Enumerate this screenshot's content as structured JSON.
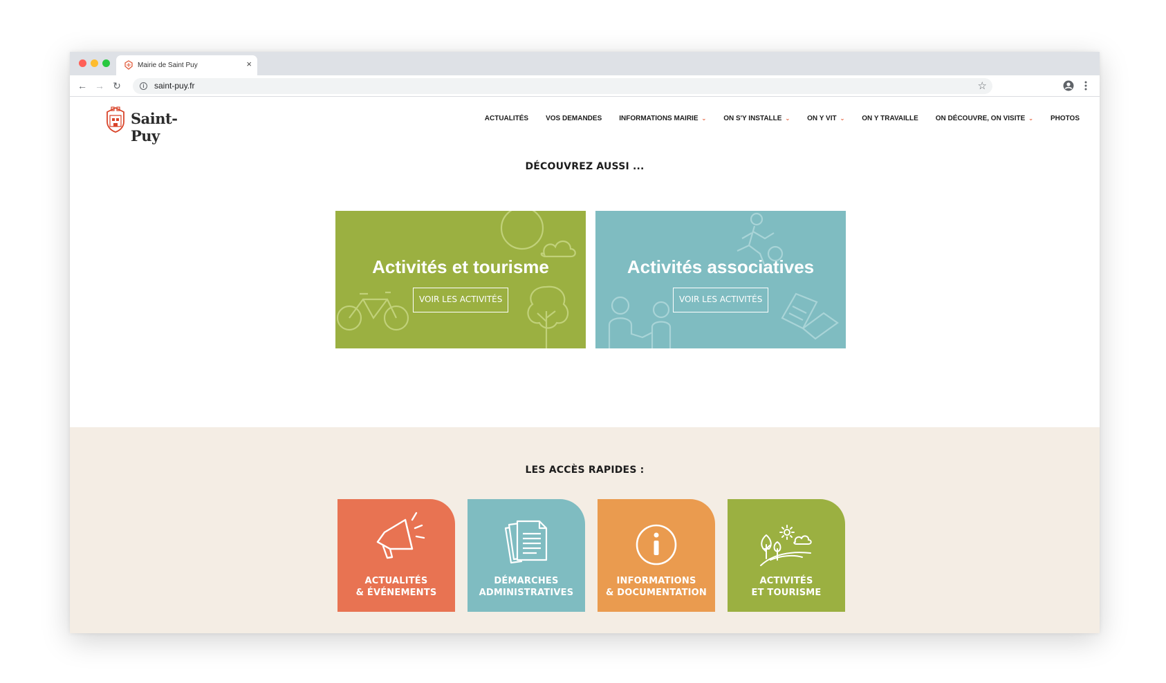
{
  "browser": {
    "tab_title": "Mairie de Saint Puy",
    "tab_close": "×",
    "url": "saint-puy.fr",
    "back": "←",
    "forward": "→",
    "reload": "↻",
    "info": "i",
    "star": "☆"
  },
  "site": {
    "logo_text": "Saint-Puy",
    "nav": [
      {
        "label": "ACTUALITÉS",
        "has_dropdown": false
      },
      {
        "label": "VOS DEMANDES",
        "has_dropdown": false
      },
      {
        "label": "INFORMATIONS MAIRIE",
        "has_dropdown": true
      },
      {
        "label": "ON S'Y INSTALLE",
        "has_dropdown": true
      },
      {
        "label": "ON Y VIT",
        "has_dropdown": true
      },
      {
        "label": "ON Y TRAVAILLE",
        "has_dropdown": false
      },
      {
        "label": "ON DÉCOUVRE, ON VISITE",
        "has_dropdown": true
      },
      {
        "label": "PHOTOS",
        "has_dropdown": false
      }
    ],
    "caret": "⌄"
  },
  "discover": {
    "title": "DÉCOUVREZ AUSSI ...",
    "cards": [
      {
        "title": "Activités et tourisme",
        "button": "VOIR LES ACTIVITÉS",
        "color": "#9bb041"
      },
      {
        "title": "Activités associatives",
        "button": "VOIR LES ACTIVITÉS",
        "color": "#7fbcc1"
      }
    ]
  },
  "quick_access": {
    "title": "LES ACCÈS RAPIDES :",
    "tiles": [
      {
        "line1": "ACTUALITÉS",
        "line2": "& ÉVÉNEMENTS",
        "color": "#e87352",
        "icon": "megaphone-icon"
      },
      {
        "line1": "DÉMARCHES",
        "line2": "ADMINISTRATIVES",
        "color": "#7fbcc1",
        "icon": "documents-icon"
      },
      {
        "line1": "INFORMATIONS",
        "line2": "& DOCUMENTATION",
        "color": "#ea9b4f",
        "icon": "info-icon"
      },
      {
        "line1": "ACTIVITÉS",
        "line2": "ET TOURISME",
        "color": "#9bb041",
        "icon": "landscape-icon"
      }
    ]
  }
}
